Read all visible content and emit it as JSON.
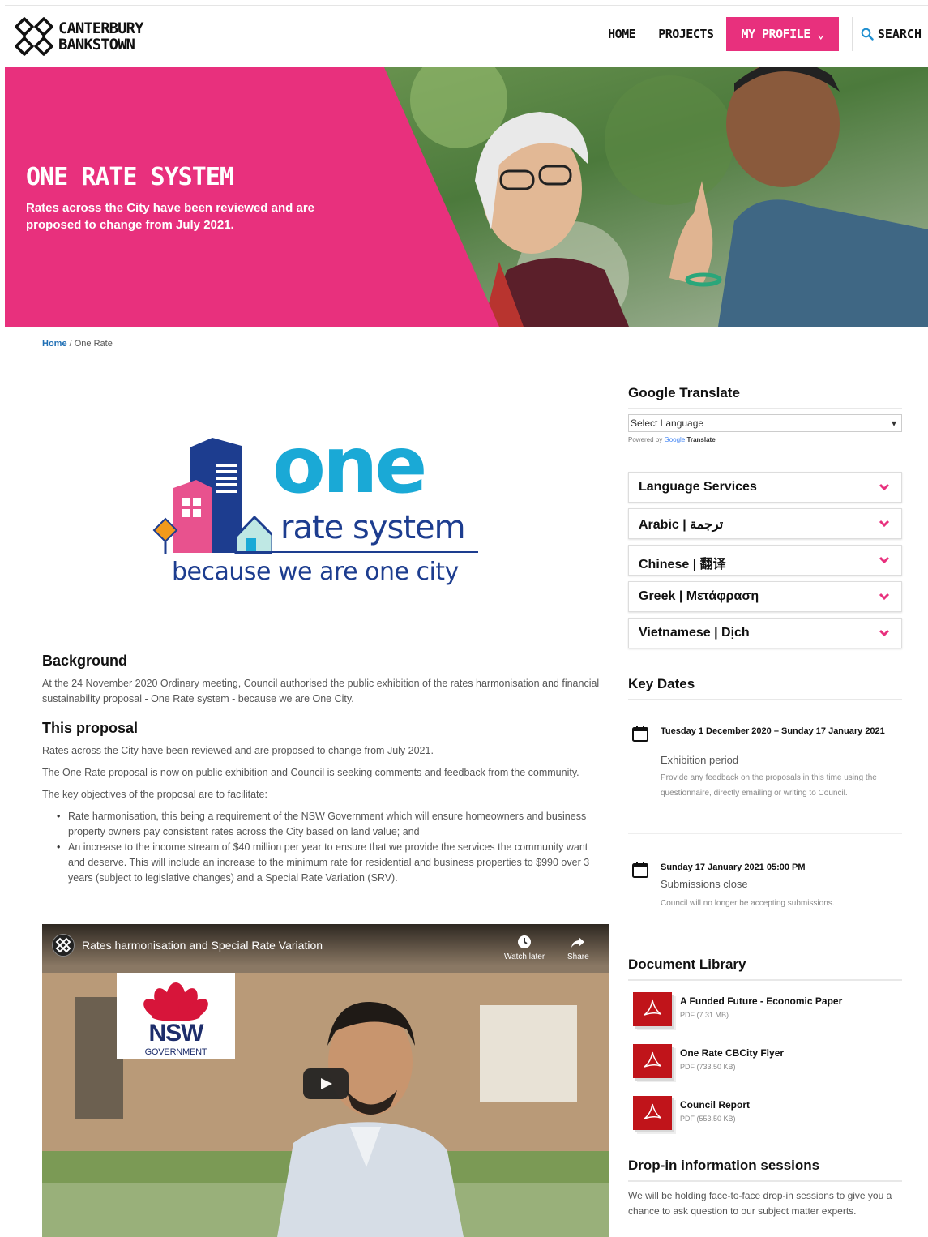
{
  "header": {
    "logo_line1": "CANTERBURY",
    "logo_line2": "BANKSTOWN",
    "nav": {
      "home": "HOME",
      "projects": "PROJECTS",
      "my_profile": "MY PROFILE ⌄",
      "search": "SEARCH"
    }
  },
  "hero": {
    "title": "ONE RATE SYSTEM",
    "subtitle": "Rates across the City have been reviewed and are proposed to change from July 2021."
  },
  "breadcrumb": {
    "home": "Home",
    "separator": " / ",
    "current": "One Rate"
  },
  "one_logo": {
    "one": "one",
    "rate_system": "rate system",
    "tagline": "because we are one city"
  },
  "main": {
    "background_heading": "Background",
    "background_text": "At the 24 November 2020 Ordinary meeting, Council authorised the public exhibition of the rates harmonisation and financial sustainability proposal - One Rate system - because we are One City.",
    "proposal_heading": "This proposal",
    "proposal_p1": "Rates across the City have been reviewed and are proposed to change from July 2021.",
    "proposal_p2": "The One Rate proposal is now on public exhibition and Council is seeking comments and feedback from the community.",
    "proposal_p3": "The key objectives of the proposal are to facilitate:",
    "bullets": [
      "Rate harmonisation, this being a requirement of the NSW Government which will ensure homeowners and business property owners pay consistent rates across the City based on land value; and",
      "An increase to the income stream of $40 million per year to ensure that we provide the services the community want and deserve. This will include an increase to the minimum rate for residential and business properties to $990 over 3 years (subject to legislative changes) and a Special Rate Variation (SRV)."
    ]
  },
  "video": {
    "title": "Rates harmonisation and Special Rate Variation",
    "watch_later": "Watch later",
    "share": "Share",
    "nsw": "NSW",
    "government": "GOVERNMENT"
  },
  "sidebar": {
    "translate_heading": "Google Translate",
    "select_language": "Select Language",
    "powered_by": "Powered by",
    "google": "Google",
    "translate": "Translate",
    "accordions": [
      "Language Services",
      "Arabic | ترجمة",
      "Chinese | 翻译",
      "Greek | Μετάφραση",
      "Vietnamese | Dịch"
    ],
    "key_dates_heading": "Key Dates",
    "key_dates": [
      {
        "date": "Tuesday 1 December 2020 – Sunday 17 January 2021",
        "title": "Exhibition period",
        "desc": "Provide any feedback on the proposals in this time using the questionnaire, directly emailing or writing to Council."
      },
      {
        "date": "Sunday 17 January 2021 05:00 PM",
        "title": "Submissions close",
        "desc": "Council will no longer be accepting submissions."
      }
    ],
    "doc_library_heading": "Document Library",
    "documents": [
      {
        "name": "A Funded Future - Economic Paper",
        "meta": "PDF (7.31 MB)"
      },
      {
        "name": "One Rate CBCity Flyer",
        "meta": "PDF (733.50 KB)"
      },
      {
        "name": "Council Report",
        "meta": "PDF (553.50 KB)"
      }
    ],
    "dropin_heading": "Drop-in information sessions",
    "dropin_text": "We will be holding face-to-face drop-in sessions to give you a chance to ask question to our subject matter experts."
  },
  "colors": {
    "brand_pink": "#e8307d",
    "link_blue": "#1f6fb5",
    "one_cyan": "#1aa9d6",
    "navy": "#1d3d8f",
    "pdf_red": "#c0141a"
  }
}
